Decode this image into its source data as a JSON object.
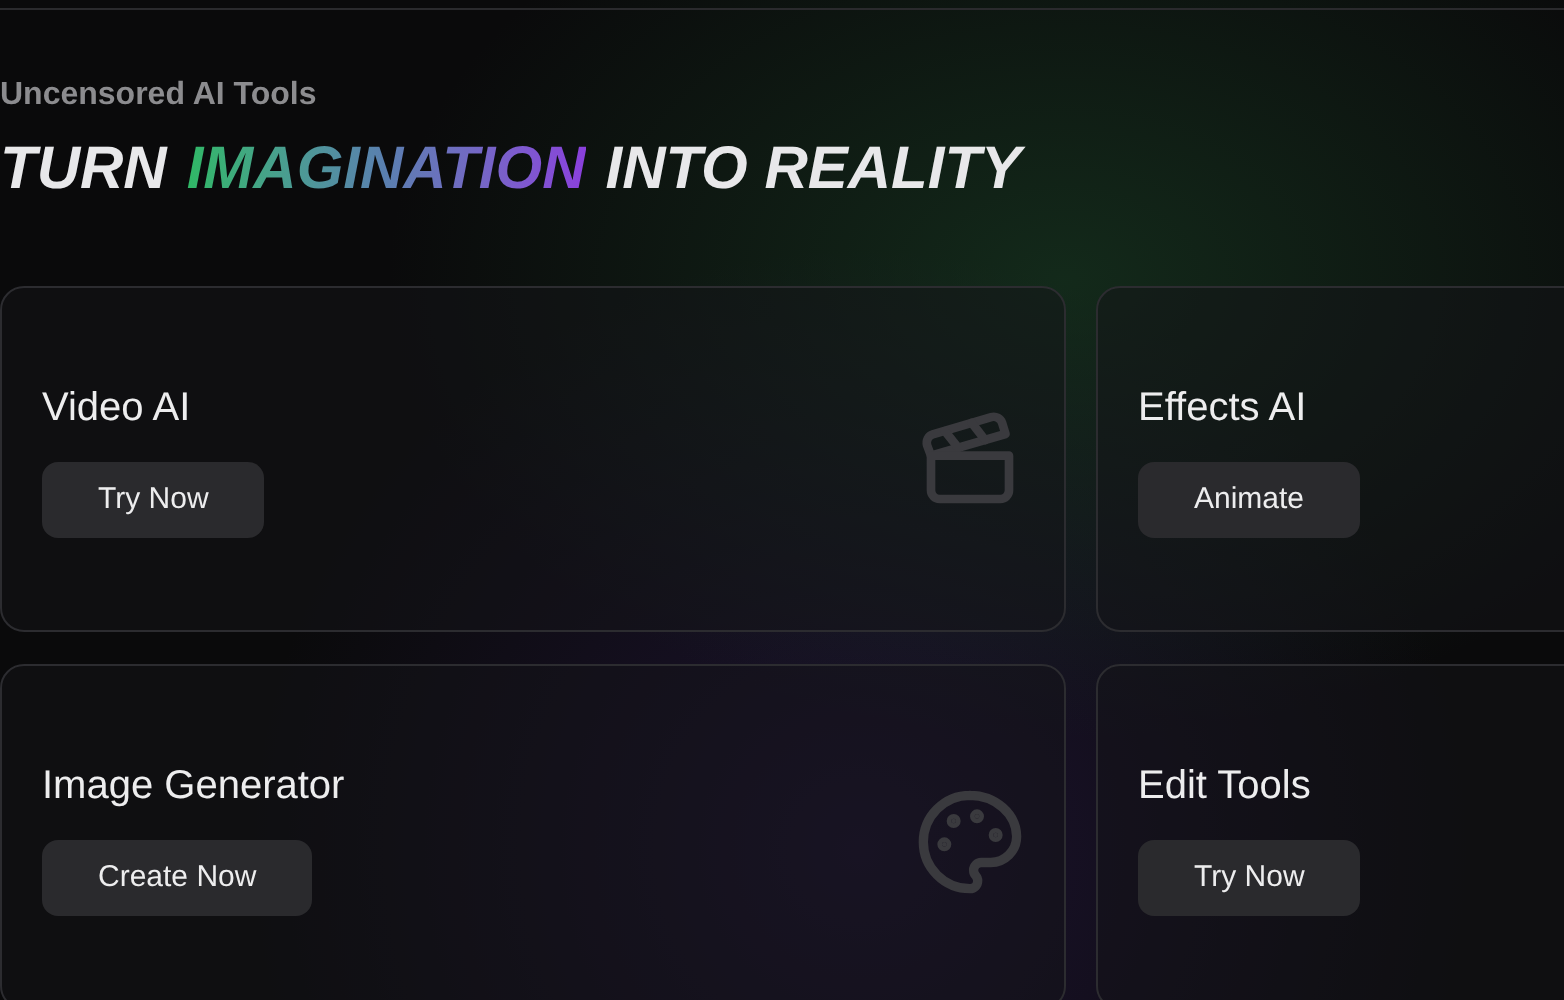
{
  "eyebrow": "Uncensored AI Tools",
  "heading": [
    {
      "text": "TURN",
      "kind": "plain"
    },
    {
      "text": "IMAGINATION",
      "kind": "gradient"
    },
    {
      "text": "INTO REALITY",
      "kind": "plain"
    }
  ],
  "cards": [
    {
      "title": "Video AI",
      "button": "Try Now"
    },
    {
      "title": "Effects AI",
      "button": "Animate"
    },
    {
      "title": "Image Generator",
      "button": "Create Now"
    },
    {
      "title": "Edit Tools",
      "button": "Try Now"
    }
  ]
}
